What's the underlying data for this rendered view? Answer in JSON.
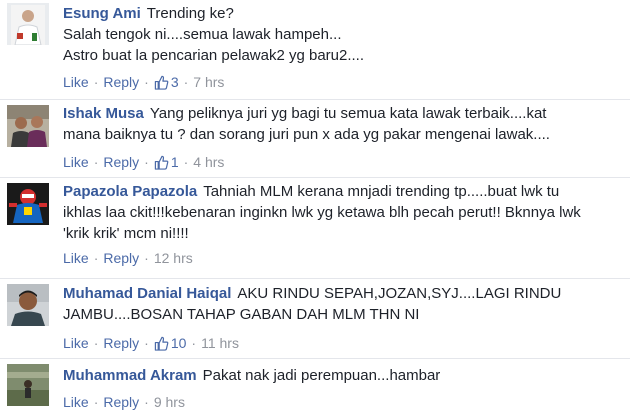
{
  "labels": {
    "like": "Like",
    "reply": "Reply",
    "separator": "·"
  },
  "colors": {
    "link": "#365899",
    "meta": "#90949c",
    "text": "#1d2129",
    "divider": "#e4e6eb"
  },
  "comments": [
    {
      "author": "Esung Ami",
      "lines": [
        "Trending ke?",
        "Salah tengok ni....semua lawak hampeh...",
        "Astro buat la pencarian pelawak2 yg baru2...."
      ],
      "likes": "3",
      "time": "7 hrs"
    },
    {
      "author": "Ishak Musa",
      "lines": [
        "Yang peliknya juri yg bagi tu semua kata lawak terbaik....kat",
        "mana baiknya tu ? dan sorang juri pun x ada yg pakar mengenai lawak...."
      ],
      "likes": "1",
      "time": "4 hrs"
    },
    {
      "author": "Papazola Papazola",
      "lines": [
        "Tahniah MLM kerana mnjadi trending tp.....buat lwk tu",
        "ikhlas laa ckit!!!kebenaran inginkn lwk yg ketawa blh pecah perut!! Bknnya lwk",
        "'krik krik' mcm ni!!!!"
      ],
      "likes": "",
      "time": "12 hrs"
    },
    {
      "author": "Muhamad Danial Haiqal",
      "lines": [
        "AKU RINDU SEPAH,JOZAN,SYJ....LAGI RINDU",
        "JAMBU....BOSAN TAHAP GABAN DAH MLM THN NI"
      ],
      "likes": "10",
      "time": "11 hrs"
    },
    {
      "author": "Muhammad Akram",
      "lines": [
        "Pakat nak jadi perempuan...hambar"
      ],
      "likes": "",
      "time": "9 hrs"
    }
  ]
}
